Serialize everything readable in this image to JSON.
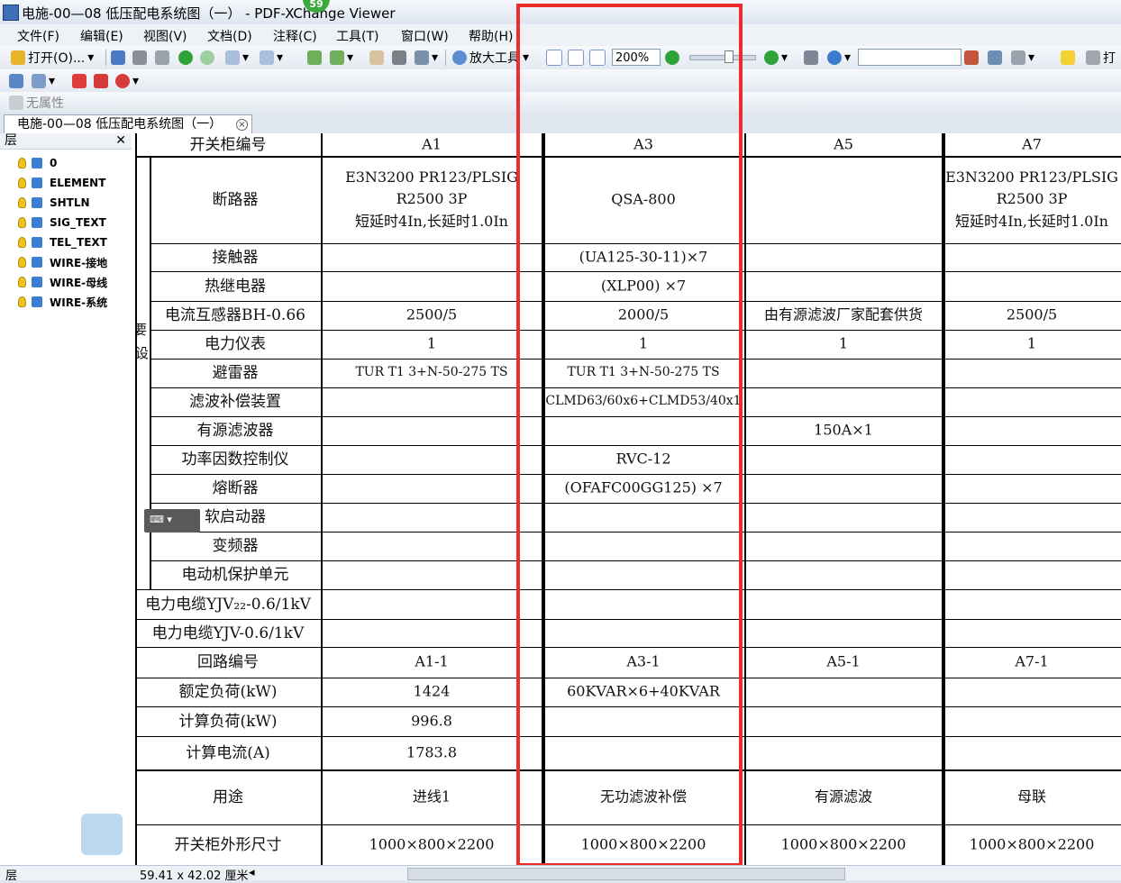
{
  "window": {
    "title": "电施-00—08 低压配电系统图（一） - PDF-XChange Viewer",
    "notification_count": "59"
  },
  "menu": [
    "文件(F)",
    "编辑(E)",
    "视图(V)",
    "文档(D)",
    "注释(C)",
    "工具(T)",
    "窗口(W)",
    "帮助(H)"
  ],
  "toolbar": {
    "open_label": "打开(O)...",
    "zoom_tool_label": "放大工具",
    "zoom_value": "200%",
    "print_label": "打",
    "no_property_label": "无属性"
  },
  "tab": {
    "label": "电施-00—08 低压配电系统图（一）"
  },
  "layers_panel": {
    "title": "层",
    "items": [
      "0",
      "ELEMENT",
      "SHTLN",
      "SIG_TEXT",
      "TEL_TEXT",
      "WIRE-接地",
      "WIRE-母线",
      "WIRE-系统"
    ]
  },
  "drawing": {
    "group_label": "主要设备",
    "columns": [
      "A1",
      "A3",
      "A5",
      "A7"
    ],
    "rows": [
      {
        "label": "开关柜编号",
        "cells": [
          "A1",
          "A3",
          "A5",
          "A7"
        ]
      },
      {
        "label": "断路器",
        "cells": [
          "E3N3200  PR123/PLSIG\nR2500  3P\n短延时4In,长延时1.0In",
          "QSA-800",
          "",
          "E3N3200  PR123/PLSIG\nR2500  3P\n短延时4In,长延时1.0In"
        ]
      },
      {
        "label": "接触器",
        "cells": [
          "",
          "(UA125-30-11)×7",
          "",
          ""
        ]
      },
      {
        "label": "热继电器",
        "cells": [
          "",
          "(XLP00)  ×7",
          "",
          ""
        ]
      },
      {
        "label": "电流互感器BH-0.66",
        "cells": [
          "2500/5",
          "2000/5",
          "由有源滤波厂家配套供货",
          "2500/5"
        ]
      },
      {
        "label": "电力仪表",
        "cells": [
          "1",
          "1",
          "1",
          "1"
        ]
      },
      {
        "label": "避雷器",
        "cells": [
          "TUR T1 3+N-50-275 TS",
          "TUR T1 3+N-50-275 TS",
          "",
          ""
        ]
      },
      {
        "label": "滤波补偿装置",
        "cells": [
          "",
          "CLMD63/60x6+CLMD53/40x1",
          "",
          ""
        ]
      },
      {
        "label": "有源滤波器",
        "cells": [
          "",
          "",
          "150A×1",
          ""
        ]
      },
      {
        "label": "功率因数控制仪",
        "cells": [
          "",
          "RVC-12",
          "",
          ""
        ]
      },
      {
        "label": "熔断器",
        "cells": [
          "",
          "(OFAFC00GG125)  ×7",
          "",
          ""
        ]
      },
      {
        "label": "软启动器",
        "cells": [
          "",
          "",
          "",
          ""
        ]
      },
      {
        "label": "变频器",
        "cells": [
          "",
          "",
          "",
          ""
        ]
      },
      {
        "label": "电动机保护单元",
        "cells": [
          "",
          "",
          "",
          ""
        ]
      },
      {
        "label": "电力电缆YJV₂₂-0.6/1kV",
        "cells": [
          "",
          "",
          "",
          ""
        ]
      },
      {
        "label": "电力电缆YJV-0.6/1kV",
        "cells": [
          "",
          "",
          "",
          ""
        ]
      },
      {
        "label": "回路编号",
        "cells": [
          "A1-1",
          "A3-1",
          "A5-1",
          "A7-1"
        ]
      },
      {
        "label": "额定负荷(kW)",
        "cells": [
          "1424",
          "60KVAR×6+40KVAR",
          "",
          ""
        ]
      },
      {
        "label": "计算负荷(kW)",
        "cells": [
          "996.8",
          "",
          "",
          ""
        ]
      },
      {
        "label": "计算电流(A)",
        "cells": [
          "1783.8",
          "",
          "",
          ""
        ]
      },
      {
        "label": "用途",
        "cells": [
          "进线1",
          "无功滤波补偿",
          "有源滤波",
          "母联"
        ]
      },
      {
        "label": "开关柜外形尺寸",
        "cells": [
          "1000×800×2200",
          "1000×800×2200",
          "1000×800×2200",
          "1000×800×2200"
        ]
      }
    ]
  },
  "status": {
    "page_size": "59.41 x 42.02 厘米"
  },
  "colors": {
    "highlight": "#ee2c2c",
    "toolbar_bg": "#e4eaf2"
  }
}
